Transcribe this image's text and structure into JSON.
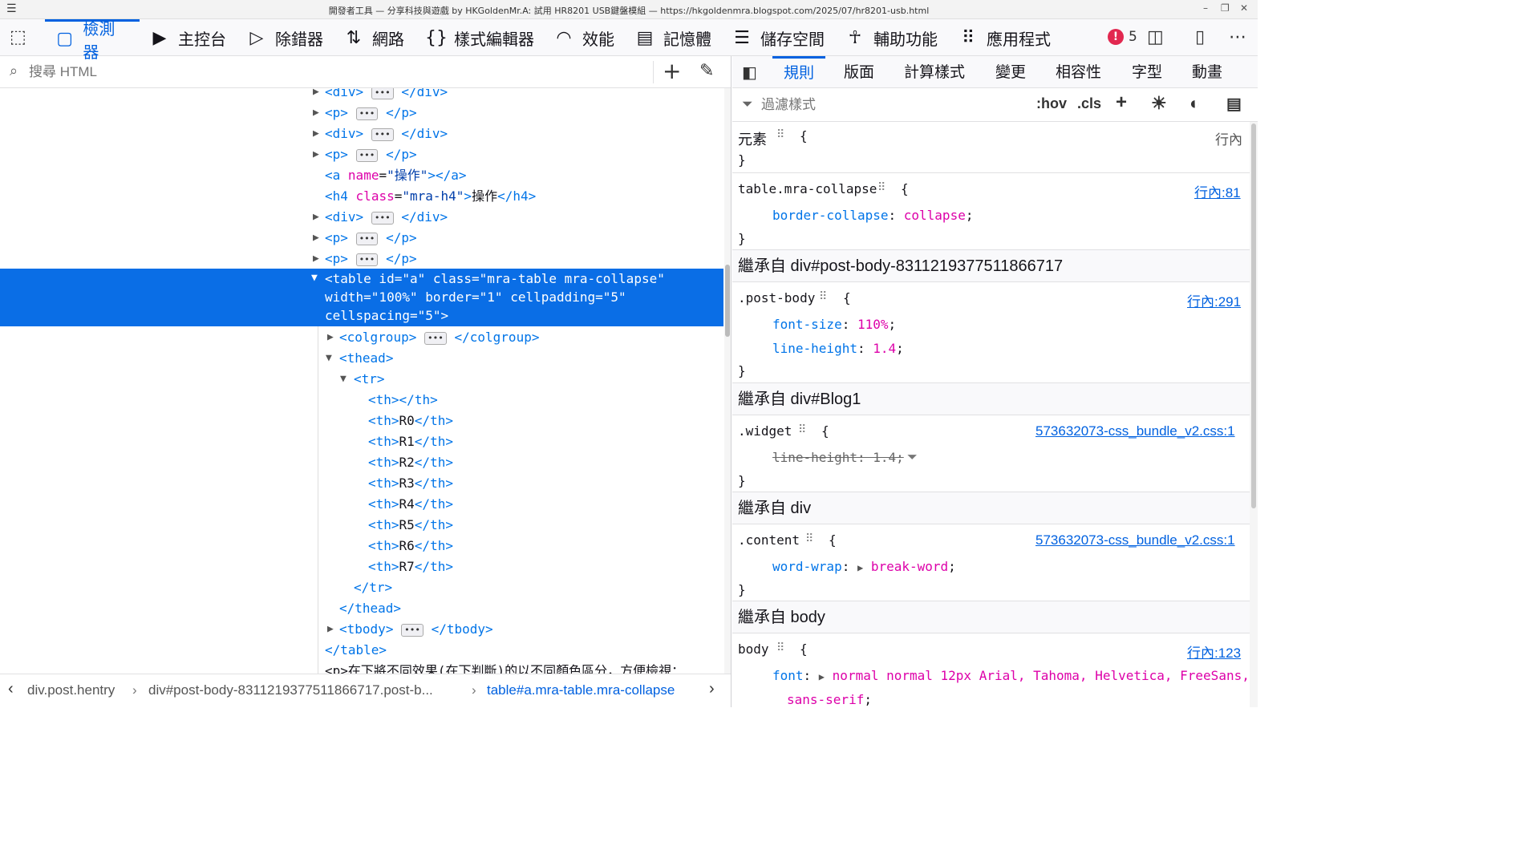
{
  "window": {
    "title": "開發者工具 — 分享科技與遊戲 by HKGoldenMr.A: 試用 HR8201 USB鍵盤模組 — https://hkgoldenmra.blogspot.com/2025/07/hr8201-usb.html",
    "menu_icon": "☰",
    "minimize": "–",
    "restore": "❐",
    "close": "✕"
  },
  "toolbar": {
    "tools": [
      {
        "label": "檢測器",
        "icon": "inspector-icon",
        "glyph": "▢"
      },
      {
        "label": "主控台",
        "icon": "console-icon",
        "glyph": "▶"
      },
      {
        "label": "除錯器",
        "icon": "debugger-icon",
        "glyph": "▷"
      },
      {
        "label": "網路",
        "icon": "network-icon",
        "glyph": "⇅"
      },
      {
        "label": "樣式編輯器",
        "icon": "style-editor-icon",
        "glyph": "{}"
      },
      {
        "label": "效能",
        "icon": "performance-icon",
        "glyph": "◠"
      },
      {
        "label": "記憶體",
        "icon": "memory-icon",
        "glyph": "▤"
      },
      {
        "label": "儲存空間",
        "icon": "storage-icon",
        "glyph": "☰"
      },
      {
        "label": "輔助功能",
        "icon": "accessibility-icon",
        "glyph": "☥"
      },
      {
        "label": "應用程式",
        "icon": "application-icon",
        "glyph": "⠿"
      }
    ],
    "error_count": "5",
    "error_glyph": "!"
  },
  "markup": {
    "search_placeholder": "搜尋 HTML",
    "tree": {
      "l0": {
        "open": "<",
        "tag": "div",
        "close": ">",
        "end": "</div>"
      },
      "l1": {
        "tag": "p",
        "end": "</p>"
      },
      "l2": {
        "tag": "div",
        "end": "</div>"
      },
      "l3": {
        "tag": "p",
        "end": "</p>"
      },
      "l4": {
        "tag": "a",
        "attr": "name",
        "val": "\"操作\"",
        "end": "></a>"
      },
      "l5": {
        "tag": "h4",
        "attr": "class",
        "val": "\"mra-h4\"",
        "text": "操作",
        "end": "</h4>"
      },
      "l6": {
        "tag": "div",
        "end": "</div>"
      },
      "l7": {
        "tag": "p",
        "end": "</p>"
      },
      "l8": {
        "tag": "p",
        "end": "</p>"
      },
      "sel1": "<table id=\"a\" class=\"mra-table mra-collapse\"",
      "sel2": "width=\"100%\" border=\"1\" cellpadding=\"5\"",
      "sel3": "cellspacing=\"5\">",
      "colgroup": {
        "tag": "colgroup",
        "end": "</colgroup>"
      },
      "thead": "thead",
      "tr": "tr",
      "th_empty": "th",
      "th_rows": [
        "R0",
        "R1",
        "R2",
        "R3",
        "R4",
        "R5",
        "R6",
        "R7"
      ],
      "tr_end": "</tr>",
      "thead_end": "</thead>",
      "tbody": {
        "tag": "tbody",
        "end": "</tbody>"
      },
      "table_end": "</table>",
      "last_partial": "<p>在下將不同效果(在下判斷)的以不同顏色區分，方便檢視："
    },
    "breadcrumbs": {
      "c1": "div.post.hentry",
      "c2": "div#post-body-8311219377511866717.post-b...",
      "c3": "table#a.mra-table.mra-collapse"
    }
  },
  "rules_panel": {
    "tabs": [
      "規則",
      "版面",
      "計算樣式",
      "變更",
      "相容性",
      "字型",
      "動畫"
    ],
    "filter_placeholder": "過濾樣式",
    "hov": ":hov",
    "cls": ".cls",
    "element_label": "元素",
    "element_src": "行內",
    "r1": {
      "selector": "table.mra-collapse",
      "src": "行內:81",
      "prop": "border-collapse",
      "val": "collapse"
    },
    "inh1": "繼承自 div#post-body-8311219377511866717",
    "r2": {
      "selector": ".post-body",
      "src": "行內:291",
      "p1": "font-size",
      "v1": "110%",
      "p2": "line-height",
      "v2": "1.4"
    },
    "inh2": "繼承自 div#Blog1",
    "r3": {
      "selector": ".widget",
      "src": "573632073-css_bundle_v2.css:1",
      "strike": "line-height: 1.4;"
    },
    "inh3": "繼承自 div",
    "r4": {
      "selector": ".content",
      "src": "573632073-css_bundle_v2.css:1",
      "prop": "word-wrap",
      "val": "break-word"
    },
    "inh4": "繼承自 body",
    "r5": {
      "selector": "body",
      "src": "行內:123",
      "prop": "font",
      "val": "normal normal 12px Arial, Tahoma, Helvetica, FreeSans,",
      "val2": "sans-serif"
    }
  },
  "colors": {
    "accent": "#0061e0",
    "selection": "#0a6ee6",
    "tag": "#0074e8",
    "attr": "#dd00a9",
    "error": "#e22850"
  }
}
